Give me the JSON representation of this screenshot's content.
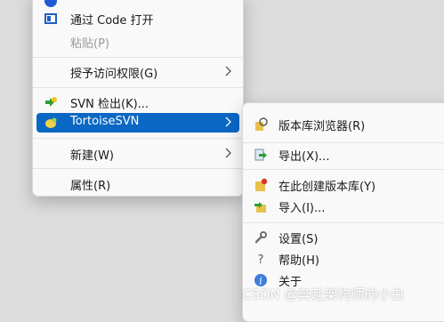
{
  "main_menu": {
    "items": [
      {
        "label": "通过 Code 打开",
        "icon": "vscode-icon"
      },
      {
        "label": "粘贴(P)",
        "disabled": true
      },
      {
        "label": "授予访问权限(G)",
        "has_submenu": true
      },
      {
        "label": "SVN 检出(K)...",
        "icon": "svn-checkout-icon"
      },
      {
        "label": "TortoiseSVN",
        "icon": "tortoisesvn-icon",
        "selected": true,
        "has_submenu": true
      },
      {
        "label": "新建(W)",
        "has_submenu": true
      },
      {
        "label": "属性(R)"
      }
    ]
  },
  "sub_menu": {
    "items": [
      {
        "label": "版本库浏览器(R)",
        "icon": "repo-browser-icon"
      },
      {
        "label": "导出(X)...",
        "icon": "export-icon"
      },
      {
        "label": "在此创建版本库(Y)",
        "icon": "create-repo-icon"
      },
      {
        "label": "导入(I)...",
        "icon": "import-icon"
      },
      {
        "label": "设置(S)",
        "icon": "wrench-icon"
      },
      {
        "label": "帮助(H)",
        "icon": "help-icon"
      },
      {
        "label": "关于",
        "icon": "info-icon"
      }
    ]
  },
  "watermark": "CSDN @奔赴架构师的小白",
  "colors": {
    "highlight": "#0b67c4",
    "menu_bg": "#f9f9f9"
  }
}
